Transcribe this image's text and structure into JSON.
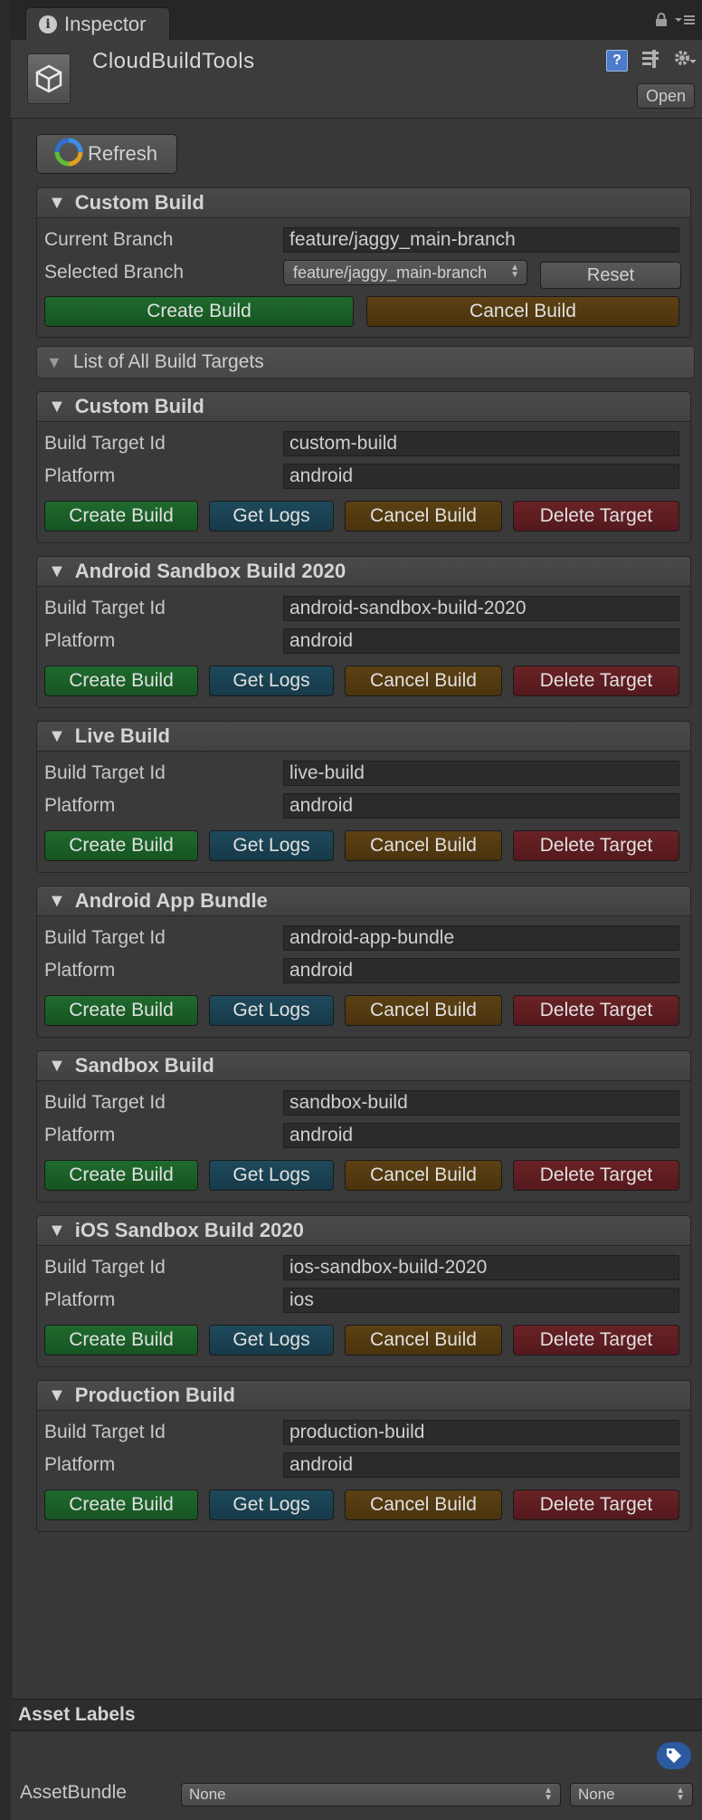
{
  "tab": {
    "label": "Inspector"
  },
  "header": {
    "title": "CloudBuildTools",
    "open_label": "Open"
  },
  "toolbar": {
    "refresh_label": "Refresh"
  },
  "custom_build": {
    "title": "Custom Build",
    "current_branch_label": "Current Branch",
    "current_branch_value": "feature/jaggy_main-branch",
    "selected_branch_label": "Selected Branch",
    "selected_branch_value": "feature/jaggy_main-branch",
    "reset_label": "Reset",
    "create_label": "Create Build",
    "cancel_label": "Cancel Build"
  },
  "list_header": "List of All Build Targets",
  "labels": {
    "build_target_id": "Build Target Id",
    "platform": "Platform",
    "create": "Create Build",
    "logs": "Get Logs",
    "cancel": "Cancel Build",
    "delete": "Delete Target"
  },
  "targets": [
    {
      "title": "Custom Build",
      "id": "custom-build",
      "platform": "android"
    },
    {
      "title": "Android Sandbox Build 2020",
      "id": "android-sandbox-build-2020",
      "platform": "android"
    },
    {
      "title": "Live Build",
      "id": "live-build",
      "platform": "android"
    },
    {
      "title": "Android App Bundle",
      "id": "android-app-bundle",
      "platform": "android"
    },
    {
      "title": "Sandbox Build",
      "id": "sandbox-build",
      "platform": "android"
    },
    {
      "title": "iOS Sandbox Build 2020",
      "id": "ios-sandbox-build-2020",
      "platform": "ios"
    },
    {
      "title": "Production Build",
      "id": "production-build",
      "platform": "android"
    }
  ],
  "asset_labels": {
    "title": "Asset Labels",
    "assetbundle_label": "AssetBundle",
    "bundle_value": "None",
    "variant_value": "None"
  },
  "colors": {
    "create": "#1f6a2e",
    "logs": "#1e4a5c",
    "cancel": "#5c4114",
    "delete": "#6a2226"
  }
}
